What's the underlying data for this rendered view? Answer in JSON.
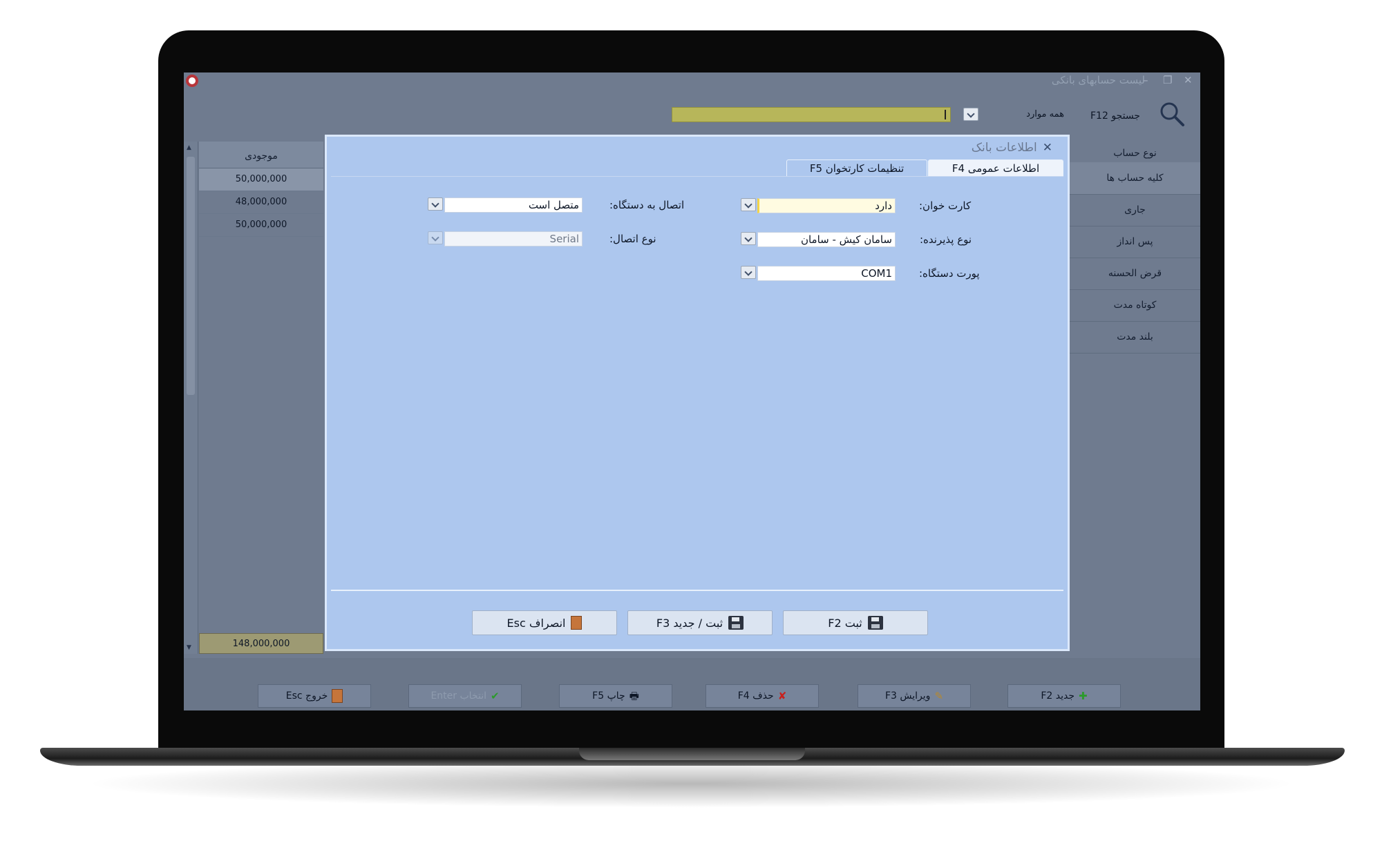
{
  "window": {
    "title": "لیست حسابهای بانکی",
    "minimize": "–",
    "restore": "❐",
    "close": "✕"
  },
  "search": {
    "label": "جستجو F12",
    "filter_value": "همه موارد"
  },
  "balances": {
    "header": "موجودی",
    "rows": [
      "50,000,000",
      "48,000,000",
      "50,000,000"
    ],
    "total": "148,000,000"
  },
  "categories": {
    "header": "نوع حساب",
    "items": [
      "کلیه حساب ها",
      "جاری",
      "پس انداز",
      "قرض الحسنه",
      "کوتاه مدت",
      "بلند مدت"
    ]
  },
  "toolbar": {
    "new": "جدید F2",
    "edit": "ویرایش F3",
    "delete": "حذف F4",
    "print": "چاپ F5",
    "select": "انتخاب Enter",
    "exit": "خروج Esc"
  },
  "dialog": {
    "title": "اطلاعات بانک",
    "tabs": [
      "اطلاعات عمومی F4",
      "تنظیمات کارتخوان F5"
    ],
    "fields": {
      "card_reader_label": "کارت خوان:",
      "card_reader_value": "دارد",
      "acceptor_type_label": "نوع پذیرنده:",
      "acceptor_type_value": "سامان کیش - سامان",
      "device_port_label": "پورت دستگاه:",
      "device_port_value": "COM1",
      "device_connection_label": "اتصال به دستگاه:",
      "device_connection_value": "متصل است",
      "connection_type_label": "نوع اتصال:",
      "connection_type_value": "Serial"
    },
    "buttons": {
      "save": "ثبت F2",
      "save_new": "ثبت / جدید F3",
      "cancel": "انصراف Esc"
    }
  },
  "colors": {
    "screen_bg": "#6f7b8f",
    "dialog_bg": "#adc7ee",
    "search_input": "#b7b65a",
    "total_bg": "#9d9a73"
  }
}
